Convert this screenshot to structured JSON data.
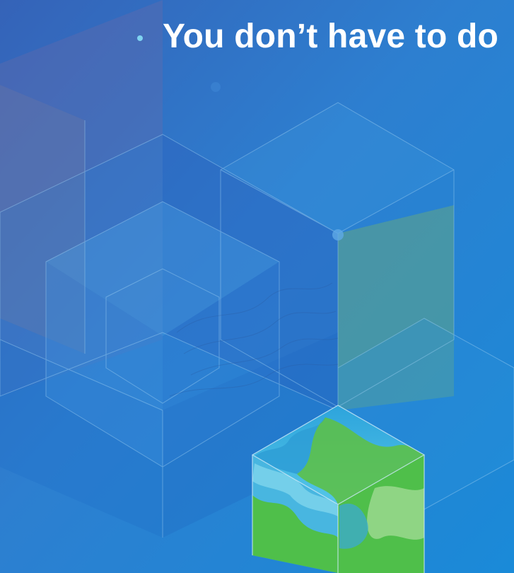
{
  "slide": {
    "bullet_text": "You don’t have to do"
  },
  "colors": {
    "background_top": "#2b6fc6",
    "background_bottom": "#1b8fdc",
    "text": "#ffffff",
    "bullet": "#7fd3f0",
    "cube_outline": "#9fd0f2",
    "map_water": "#3fb6e0",
    "map_land": "#5cc04a"
  },
  "icons": {
    "bullet": "bullet-dot-icon",
    "decoration": "isometric-cube-graphic"
  }
}
